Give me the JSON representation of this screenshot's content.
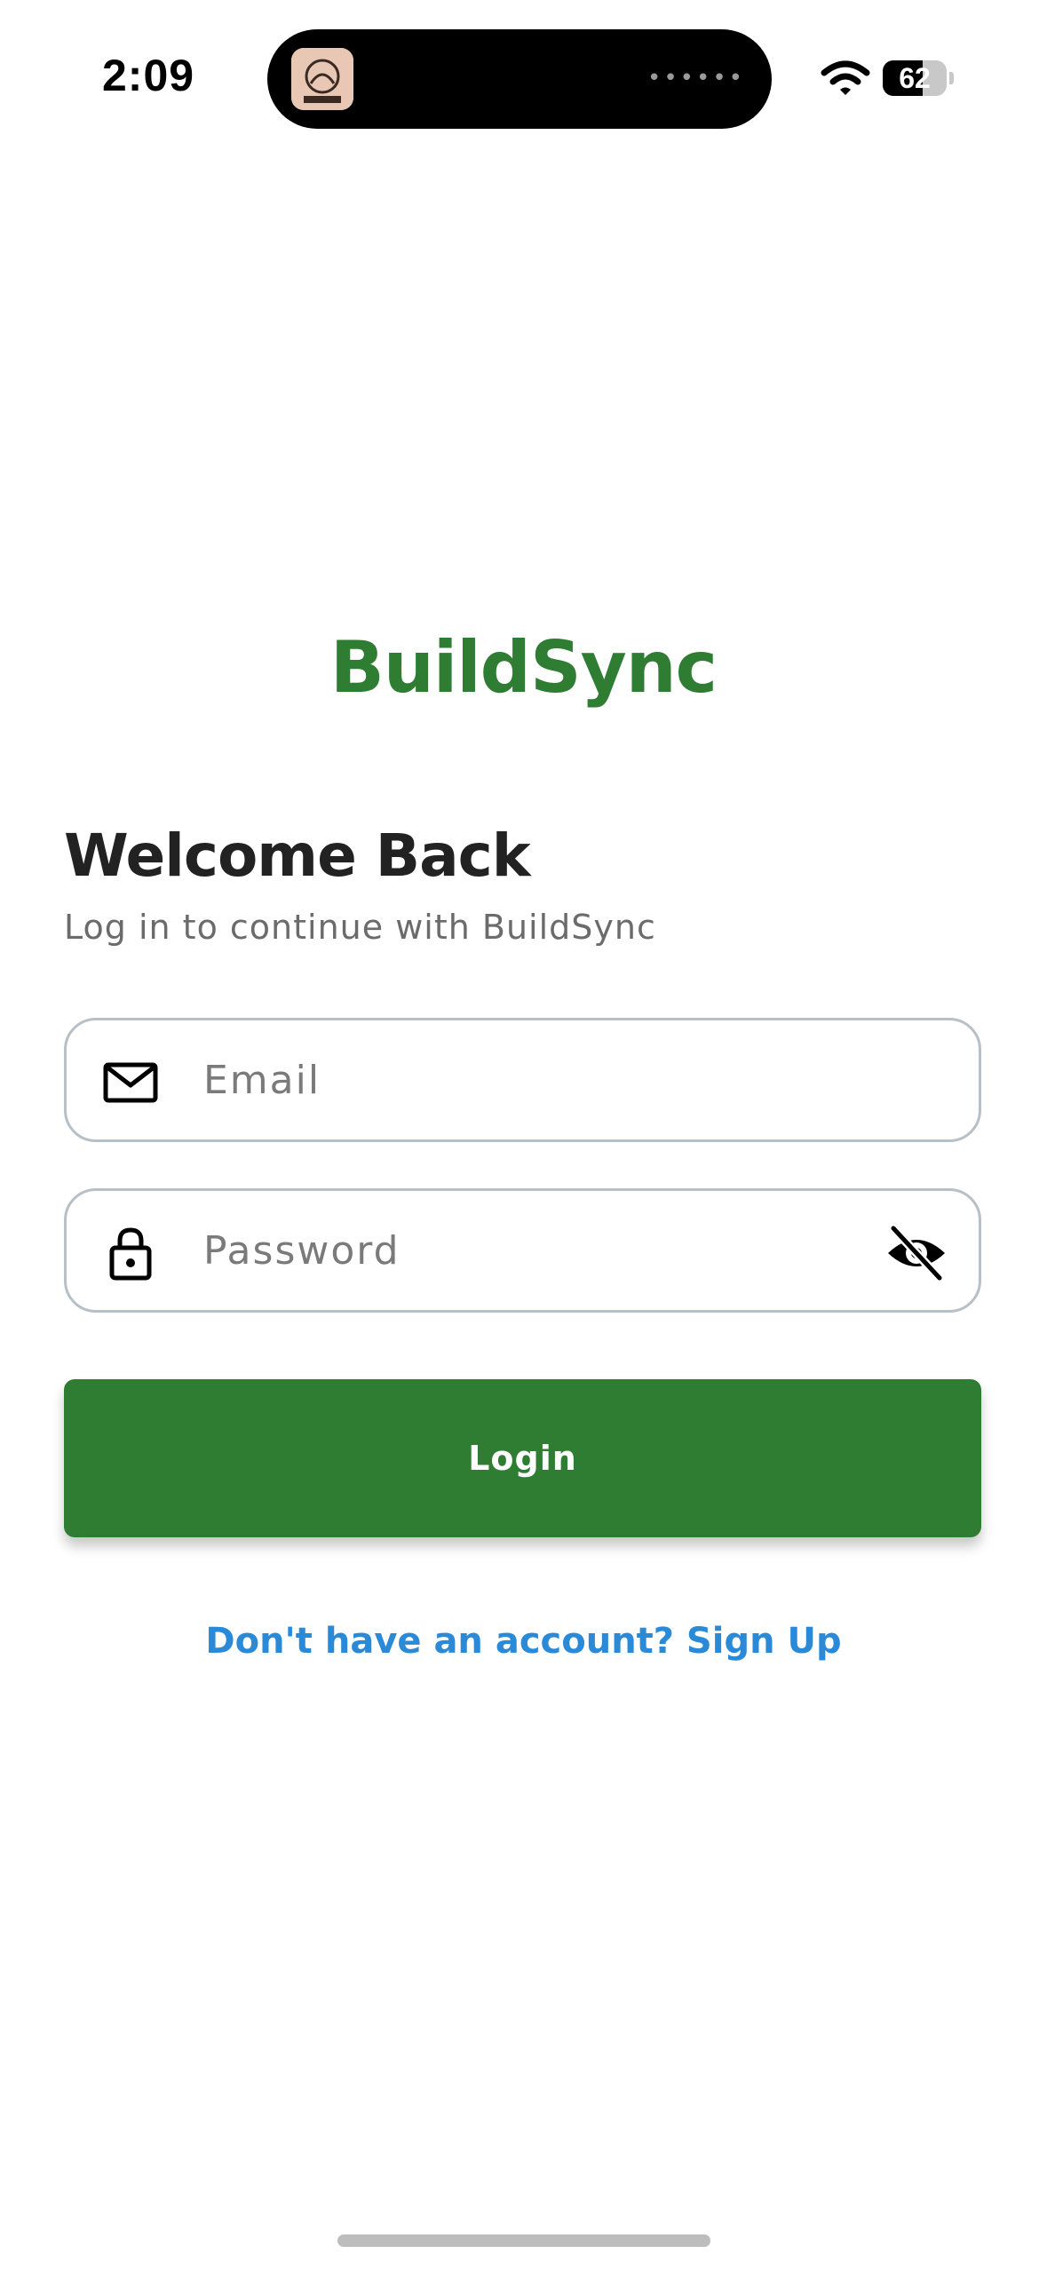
{
  "status_bar": {
    "time": "2:09",
    "battery_level": "62",
    "battery_fraction": 0.62,
    "island_activity": "••••••",
    "icons": [
      "app-icon",
      "wifi-icon",
      "battery-icon"
    ]
  },
  "brand": {
    "name": "BuildSync",
    "color": "#2e7d32"
  },
  "header": {
    "title": "Welcome Back",
    "subtitle": "Log in to continue with BuildSync"
  },
  "form": {
    "email": {
      "value": "",
      "placeholder": "Email",
      "icon": "mail-icon"
    },
    "password": {
      "value": "",
      "placeholder": "Password",
      "icon": "lock-icon",
      "toggle_icon": "eye-off-icon"
    },
    "login_label": "Login",
    "signup_link": "Don't have an account? Sign Up"
  },
  "colors": {
    "primary": "#2e7d32",
    "link": "#2a8ad8",
    "field_border": "#b6c0c6"
  }
}
